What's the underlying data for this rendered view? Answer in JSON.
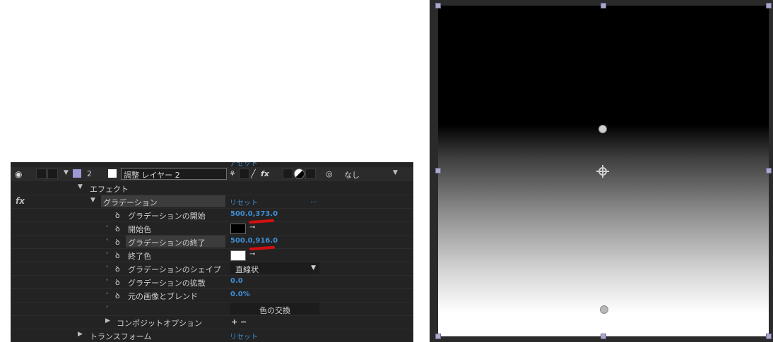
{
  "layer": {
    "number": "2",
    "name": "調整 レイヤー 2",
    "parent": "なし",
    "header_partial": "アセット"
  },
  "effects": {
    "group_label": "エフェクト",
    "fx_label": "fx",
    "effect_name": "グラデーション",
    "reset": "リセット",
    "more": "...",
    "props": [
      {
        "label": "グラデーションの開始",
        "value": "500.0,373.0"
      },
      {
        "label": "開始色",
        "value": ""
      },
      {
        "label": "グラデーションの終了",
        "value": "500.0,916.0"
      },
      {
        "label": "終了色",
        "value": ""
      },
      {
        "label": "グラデーションのシェイプ",
        "value": "直線状"
      },
      {
        "label": "グラデーションの拡散",
        "value": "0.0"
      },
      {
        "label": "元の画像とブレンド",
        "value": "0.0%"
      }
    ],
    "swap_button": "色の交換",
    "composite_options": "コンポジットオプション",
    "plus_minus": "+ −"
  },
  "transform": {
    "label": "トランスフォーム",
    "reset": "リセット"
  },
  "icons": {
    "eye": "eye-icon",
    "stopwatch": "stopwatch-icon",
    "eyedropper": "eyedropper-icon",
    "dropdown": "chevron-down-icon"
  },
  "colors": {
    "panel_bg": "#232323",
    "value_blue": "#3f8fd6",
    "annotation_red": "#d21010",
    "start_color": "#000000",
    "end_color": "#ffffff"
  }
}
